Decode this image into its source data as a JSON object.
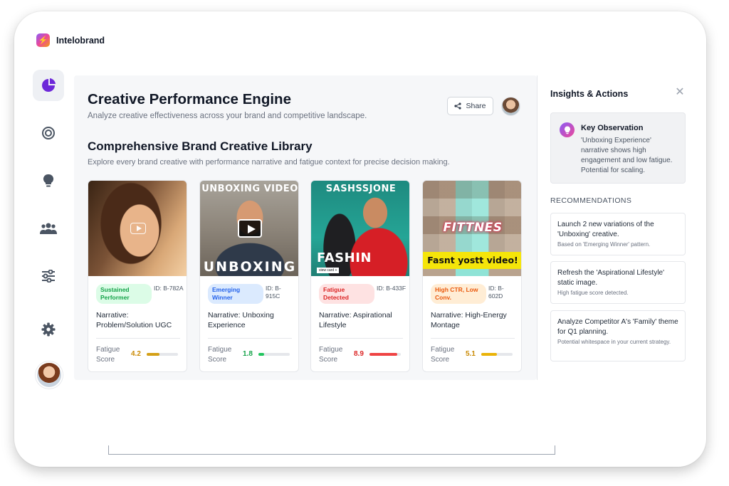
{
  "brand": {
    "name": "Intelobrand"
  },
  "header": {
    "title": "Creative Performance Engine",
    "subtitle": "Analyze creative effectiveness across your brand and competitive landscape.",
    "share_label": "Share"
  },
  "library": {
    "title": "Comprehensive Brand Creative Library",
    "subtitle": "Explore every brand creative with performance narrative and fatigue context for precise decision making.",
    "fatigue_label": "Fatigue Score",
    "cards": [
      {
        "badge": "Sustained Performer",
        "badge_color": "#16a34a",
        "id": "ID: B-782A",
        "narrative": "Narrative: Problem/Solution UGC",
        "fatigue": "4.2",
        "fatigue_pct": 42,
        "fatigue_color": "#d4a017"
      },
      {
        "badge": "Emerging Winner",
        "badge_color": "#2563eb",
        "id": "ID: B-915C",
        "narrative": "Narrative: Unboxing Experience",
        "fatigue": "1.8",
        "fatigue_pct": 18,
        "fatigue_color": "#22c55e",
        "thumb_top": "UNBOXING VIDEO",
        "thumb_bottom": "UNBOXING"
      },
      {
        "badge": "Fatigue Detected",
        "badge_color": "#dc2626",
        "id": "ID: B-433F",
        "narrative": "Narrative: Aspirational Lifestyle",
        "fatigue": "8.9",
        "fatigue_pct": 89,
        "fatigue_color": "#ef4444",
        "thumb_top": "SASHSSJONE",
        "thumb_bottom": "FASHIN",
        "thumb_tag": "view card +"
      },
      {
        "badge": "High CTR, Low Conv.",
        "badge_color": "#ea580c",
        "id": "ID: B-602D",
        "narrative": "Narrative: High-Energy Montage",
        "fatigue": "5.1",
        "fatigue_pct": 51,
        "fatigue_color": "#eab308",
        "thumb_mid": "FITTNES",
        "thumb_bottom": "Fasnt yostt video!"
      }
    ]
  },
  "panel": {
    "title": "Insights & Actions",
    "observation": {
      "title": "Key Observation",
      "text": "'Unboxing Experience' narrative shows high engagement and low fatigue. Potential for scaling."
    },
    "recommendations_heading": "RECOMMENDATIONS",
    "recommendations": [
      {
        "title": "Launch 2 new variations of the 'Unboxing' creative.",
        "sub": "Based on 'Emerging Winner' pattern."
      },
      {
        "title": "Refresh the 'Aspirational Lifestyle' static image.",
        "sub": "High fatigue score detected."
      },
      {
        "title": "Analyze Competitor A's 'Family' theme for Q1 planning.",
        "sub": "Potential whitespace in your current strategy."
      }
    ]
  },
  "nav": [
    "analytics-icon",
    "target-icon",
    "lightbulb-icon",
    "users-icon",
    "sliders-icon",
    "settings-icon"
  ]
}
